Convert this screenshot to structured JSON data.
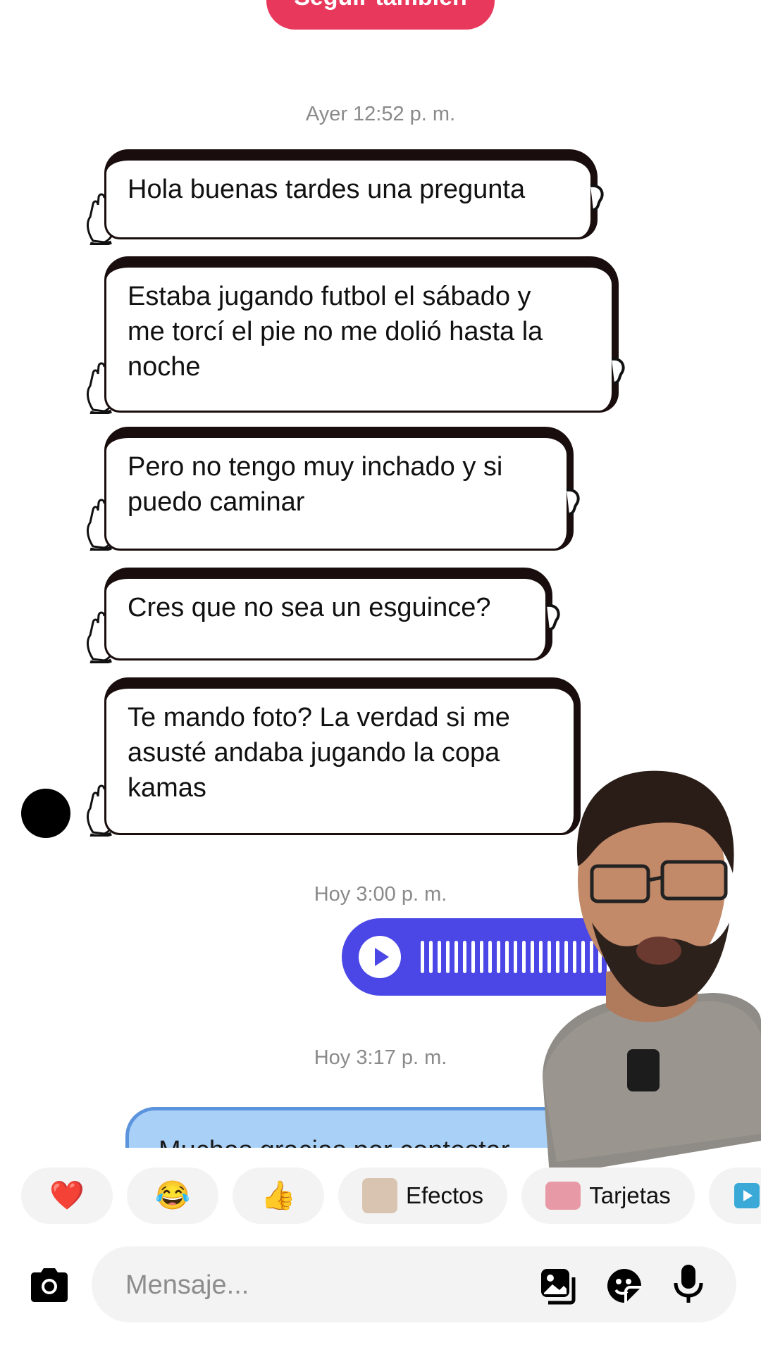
{
  "header": {
    "follow_label": "Seguir también"
  },
  "conversation": {
    "timestamp_1": "Ayer 12:52 p. m.",
    "incoming_messages": [
      {
        "lines": [
          "Hola buenas tardes una pregunta"
        ]
      },
      {
        "lines": [
          "Estaba jugando futbol el sábado y",
          "me torcí el pie no me dolió hasta la",
          "noche"
        ]
      },
      {
        "lines": [
          "Pero no tengo muy inchado y si",
          "puedo caminar"
        ]
      },
      {
        "lines": [
          "Cres que no sea un esguince?"
        ]
      },
      {
        "lines": [
          "Te mando foto? La verdad si me",
          "asusté andaba jugando la copa",
          "kamas"
        ]
      }
    ],
    "timestamp_2": "Hoy 3:00 p. m.",
    "voice_message": {
      "type": "audio",
      "color": "#4a47e6"
    },
    "timestamp_3": "Hoy 3:17 p. m.",
    "reply_preview": "Muchas gracias por contestar"
  },
  "quick_actions": {
    "heart": "❤️",
    "laugh": "😂",
    "thumbs_up": "👍",
    "effects_label": "Efectos",
    "cards_label": "Tarjetas"
  },
  "composer": {
    "placeholder": "Mensaje..."
  },
  "colors": {
    "follow": "#e8395c",
    "voice": "#4a47e6",
    "reply_bubble": "#a9d1f7"
  }
}
